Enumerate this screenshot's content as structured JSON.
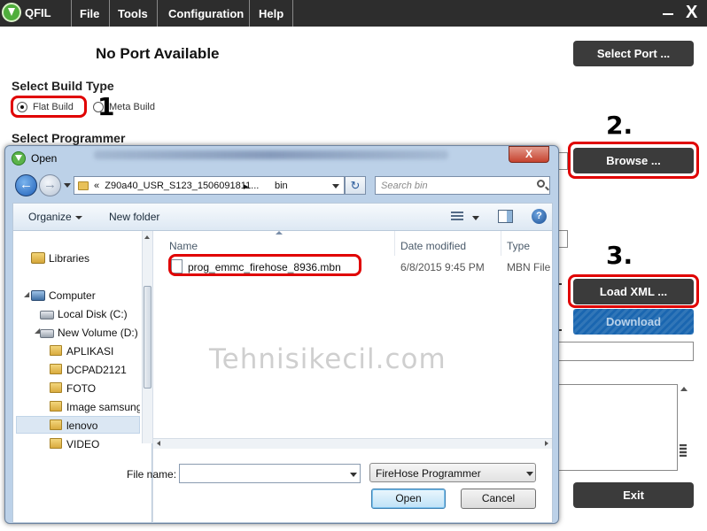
{
  "app": {
    "title": "QFIL",
    "menu": [
      "File",
      "Tools",
      "Configuration",
      "Help"
    ],
    "close_glyph": "X"
  },
  "port_status": "No Port Available",
  "buttons": {
    "select_port": "Select Port ...",
    "browse": "Browse ...",
    "load_xml": "Load XML ...",
    "download": "Download",
    "exit": "Exit"
  },
  "build_type": {
    "title": "Select Build Type",
    "options": [
      {
        "label": "Flat Build",
        "checked": true
      },
      {
        "label": "Meta Build",
        "checked": false
      }
    ]
  },
  "programmer_title": "Select Programmer",
  "annotations": [
    "1",
    "2.",
    "3."
  ],
  "watermark": "Tehnisikecil.com",
  "dialog": {
    "title": "Open",
    "close_glyph": "X",
    "address": {
      "prefix": "«",
      "path": "Z90a40_USR_S123_1506091811...",
      "separator": "▸",
      "current": "bin"
    },
    "refresh_glyph": "↻",
    "search_placeholder": "Search bin",
    "toolbar": {
      "organize": "Organize",
      "new_folder": "New folder",
      "help_glyph": "?"
    },
    "nav": [
      {
        "label": "Libraries",
        "icon": "libraries-icon"
      },
      {
        "label": "Computer",
        "icon": "computer-icon"
      },
      {
        "label": "Local Disk (C:)",
        "icon": "drive-icon"
      },
      {
        "label": "New Volume (D:)",
        "icon": "drive-icon"
      },
      {
        "label": "APLIKASI",
        "icon": "folder-icon"
      },
      {
        "label": "DCPAD2121",
        "icon": "folder-icon"
      },
      {
        "label": "FOTO",
        "icon": "folder-icon"
      },
      {
        "label": "Image samsung",
        "icon": "folder-icon"
      },
      {
        "label": "lenovo",
        "icon": "folder-icon",
        "selected": true
      },
      {
        "label": "VIDEO",
        "icon": "folder-icon"
      }
    ],
    "columns": [
      "Name",
      "Date modified",
      "Type"
    ],
    "files": [
      {
        "name": "prog_emmc_firehose_8936.mbn",
        "date": "6/8/2015 9:45 PM",
        "type": "MBN File"
      }
    ],
    "file_name_label": "File name:",
    "file_name_value": "",
    "filter": "FireHose Programmer",
    "open_label": "Open",
    "cancel_label": "Cancel"
  },
  "colors": {
    "menubar": "#2d2d2d",
    "dark_button": "#3b3b3b",
    "download_button": "#1a66b0",
    "annotation_red": "#e00000",
    "dialog_frame": "#bcd1e8"
  }
}
